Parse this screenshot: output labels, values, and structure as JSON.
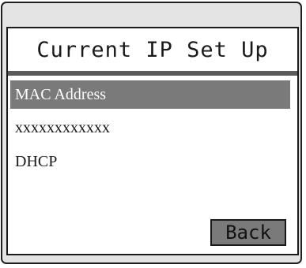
{
  "screen": {
    "title": "Current IP Set Up",
    "menu_items": [
      {
        "label": "MAC Address",
        "selected": true
      },
      {
        "label": "xxxxxxxxxxxx",
        "selected": false
      },
      {
        "label": "DHCP",
        "selected": false
      }
    ],
    "back_label": "Back"
  },
  "colors": {
    "frame_background": "#e4e4e4",
    "screen_background": "#ffffff",
    "highlight": "#7a7a7a",
    "border": "#1a1a1a"
  }
}
